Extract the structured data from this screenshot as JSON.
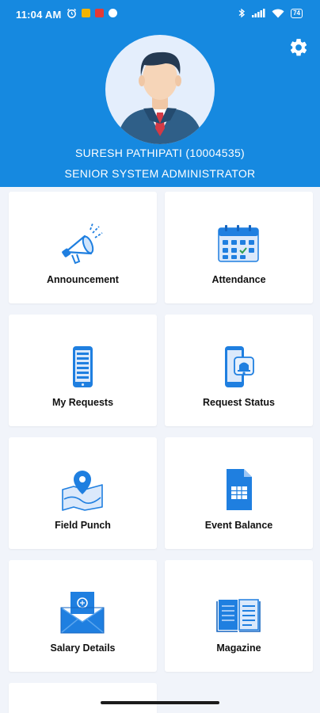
{
  "status_bar": {
    "time": "11:04 AM",
    "battery": "74"
  },
  "profile": {
    "name": "SURESH  PATHIPATI (10004535)",
    "role": "SENIOR SYSTEM ADMINISTRATOR"
  },
  "tiles": [
    {
      "label": "Announcement",
      "icon": "megaphone-icon"
    },
    {
      "label": "Attendance",
      "icon": "calendar-icon"
    },
    {
      "label": "My Requests",
      "icon": "phone-list-icon"
    },
    {
      "label": "Request Status",
      "icon": "phone-notification-icon"
    },
    {
      "label": "Field Punch",
      "icon": "map-pin-icon"
    },
    {
      "label": "Event Balance",
      "icon": "spreadsheet-icon"
    },
    {
      "label": "Salary Details",
      "icon": "envelope-money-icon"
    },
    {
      "label": "Magazine",
      "icon": "open-book-icon"
    }
  ],
  "colors": {
    "brand": "#1689e0",
    "icon_blue": "#1f7fe0",
    "background": "#f1f4fa"
  }
}
